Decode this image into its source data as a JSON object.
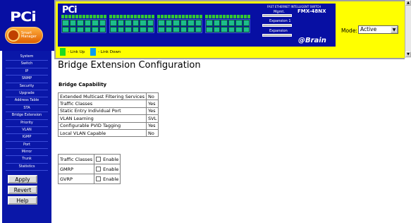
{
  "brand": {
    "logo_text": "PCi",
    "badge_text": "Smart Manager"
  },
  "nav": {
    "items": [
      {
        "label": "System"
      },
      {
        "label": "Switch"
      },
      {
        "label": "IP"
      },
      {
        "label": "SNMP"
      },
      {
        "label": "Security"
      },
      {
        "label": "Upgrade"
      },
      {
        "label": "Address Table"
      },
      {
        "label": "STA"
      },
      {
        "label": "Bridge Extension"
      },
      {
        "label": "Priority"
      },
      {
        "label": "VLAN"
      },
      {
        "label": "IGMP"
      },
      {
        "label": "Port"
      },
      {
        "label": "Mirror"
      },
      {
        "label": "Trunk"
      },
      {
        "label": "Statistics"
      }
    ],
    "apply_label": "Apply",
    "revert_label": "Revert",
    "help_label": "Help"
  },
  "switch_panel": {
    "logo_text": "PCi",
    "fe_switch_text": "FAST ETHERNET INTELLIGENT SWITCH",
    "model": "FMX-48NX",
    "mgmt_label": "Mgmt.",
    "expansion1_label": "Expansion 1",
    "expansion2_label": "Expansion",
    "ebrain_text": "@Brain",
    "legend_link_up": "- Link Up",
    "legend_link_down": "- Link Down",
    "mode_label": "Mode:",
    "mode_value": "Active",
    "colors": {
      "link_up": "#1fd91f",
      "link_down": "#0a9cf0",
      "panel_bg": "#ffff00",
      "switch_bg": "#070fa3"
    }
  },
  "page": {
    "title": "Bridge Extension Configuration",
    "capability_title": "Bridge Capability",
    "capabilities": [
      {
        "name": "Extended Multicast Filtering Services",
        "value": "No"
      },
      {
        "name": "Traffic Classes",
        "value": "Yes"
      },
      {
        "name": "Static Entry Individual Port",
        "value": "Yes"
      },
      {
        "name": "VLAN Learning",
        "value": "SVL"
      },
      {
        "name": "Configurable PVID Tagging",
        "value": "Yes"
      },
      {
        "name": "Local VLAN Capable",
        "value": "No"
      }
    ],
    "settings": [
      {
        "name": "Traffic Classes",
        "option": "Enable",
        "checked": false
      },
      {
        "name": "GMRP",
        "option": "Enable",
        "checked": false
      },
      {
        "name": "GVRP",
        "option": "Enable",
        "checked": false
      }
    ]
  }
}
